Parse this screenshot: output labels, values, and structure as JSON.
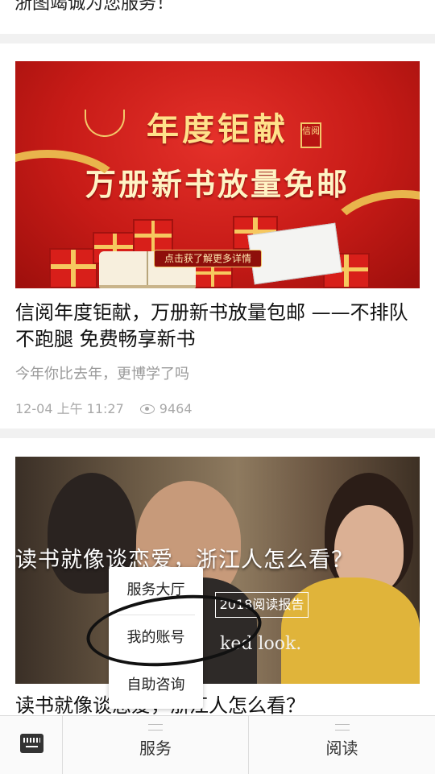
{
  "top_text": "浙图竭诚为您服务！",
  "article1": {
    "cover_title": "年度钜献",
    "cover_subtitle": "万册新书放量免邮",
    "cover_seal": "信阅",
    "cover_cta": "点击获了解更多详情",
    "title": "信阅年度钜献，万册新书放量包邮 ——不排队 不跑腿 免费畅享新书",
    "subtitle": "今年你比去年，更博学了吗",
    "time": "12-04 上午 11:27",
    "views": "9464"
  },
  "article2": {
    "cover_text": "读书就像谈恋爱，浙江人怎么看？",
    "cover_button": "2018阅读报告",
    "cover_english": "ked look.",
    "title": "读书就像谈恋爱，浙江人怎么看？"
  },
  "popup_menu": {
    "items": [
      "服务大厅",
      "我的账号",
      "自助咨询"
    ]
  },
  "bottom_bar": {
    "keyboard_icon": "keyboard-icon",
    "tabs": [
      {
        "label": "服务"
      },
      {
        "label": "阅读"
      }
    ]
  },
  "colors": {
    "banner_red": "#c71b17",
    "gold": "#ffe18a",
    "meta_gray": "#a8a8a8"
  }
}
